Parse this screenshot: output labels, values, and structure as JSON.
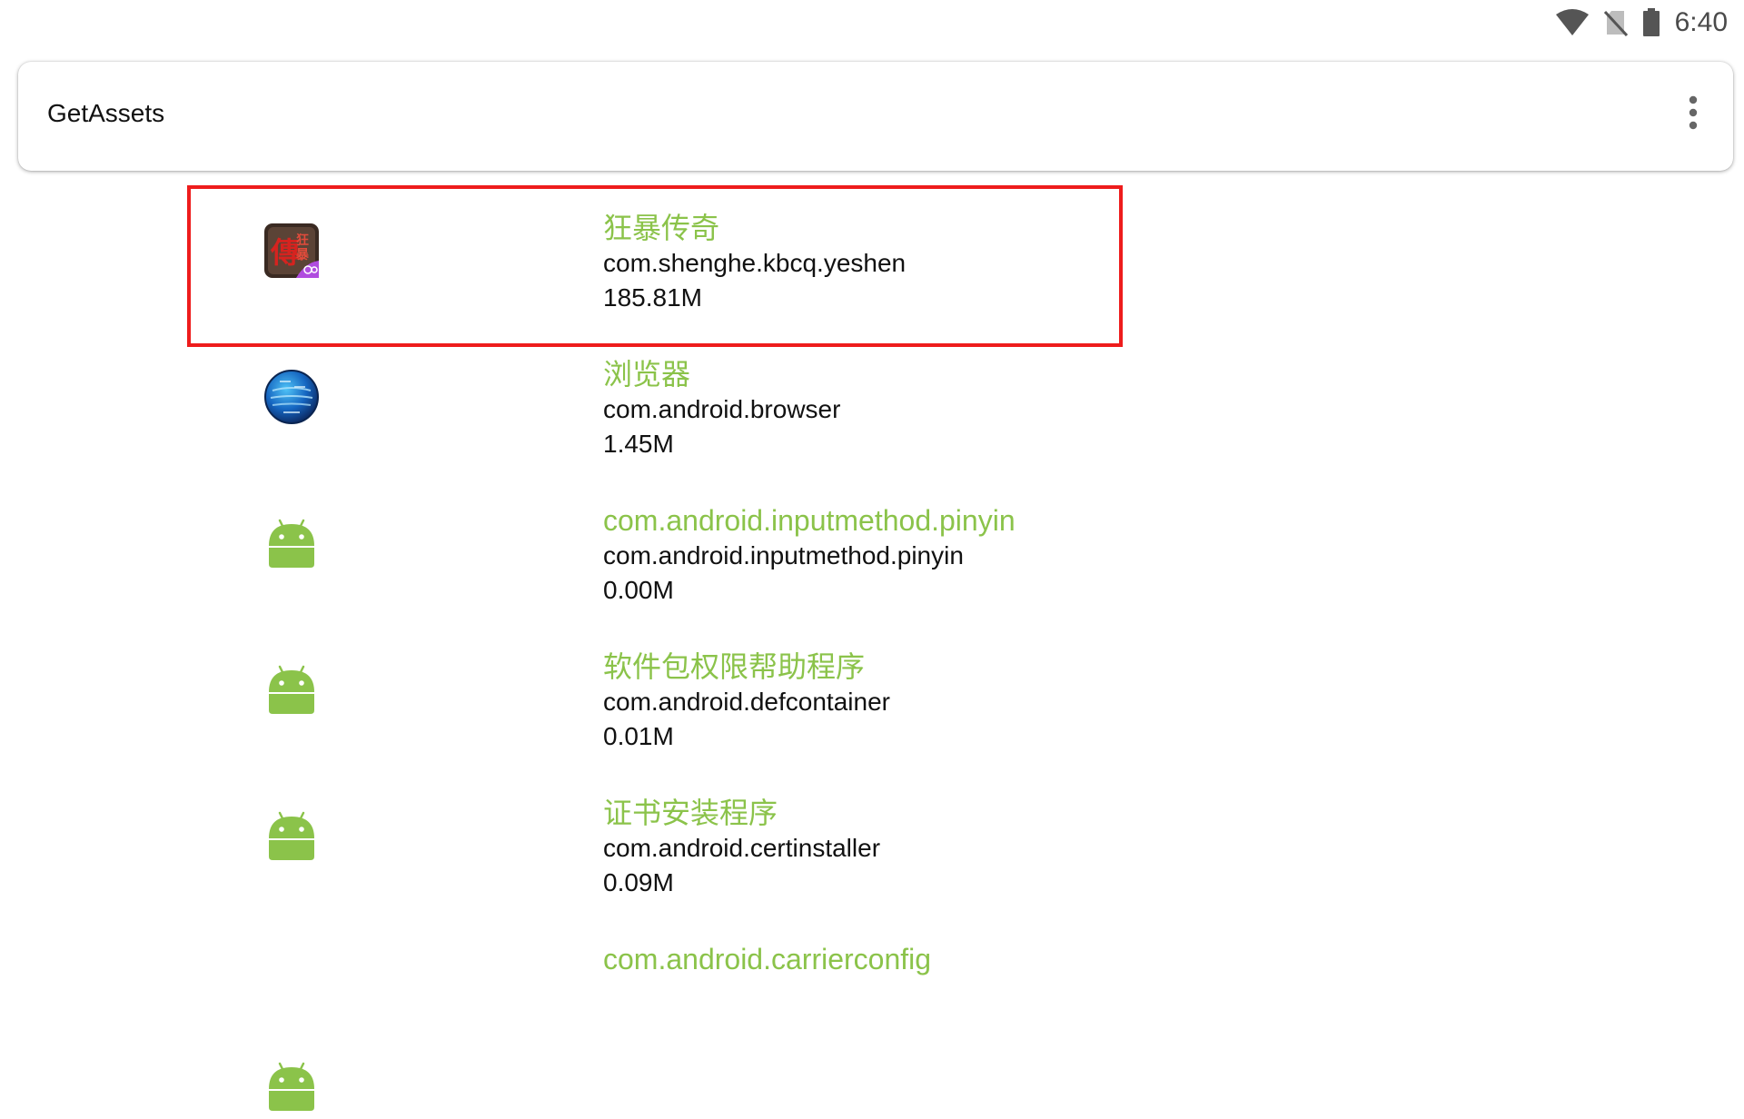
{
  "status_bar": {
    "time": "6:40",
    "icons": [
      "wifi-icon",
      "no-sim-icon",
      "battery-icon"
    ]
  },
  "app_bar": {
    "title": "GetAssets",
    "overflow_icon": "more-vert-icon"
  },
  "colors": {
    "label_green": "#8bc34a",
    "highlight_red": "#ee1c1c"
  },
  "apps": [
    {
      "label": "狂暴传奇",
      "package": "com.shenghe.kbcq.yeshen",
      "size": "185.81M",
      "icon": "game-icon"
    },
    {
      "label": "浏览器",
      "package": "com.android.browser",
      "size": "1.45M",
      "icon": "globe-icon"
    },
    {
      "label": "com.android.inputmethod.pinyin",
      "package": "com.android.inputmethod.pinyin",
      "size": "0.00M",
      "icon": "android-icon"
    },
    {
      "label": "软件包权限帮助程序",
      "package": "com.android.defcontainer",
      "size": "0.01M",
      "icon": "android-icon"
    },
    {
      "label": "证书安装程序",
      "package": "com.android.certinstaller",
      "size": "0.09M",
      "icon": "android-icon"
    },
    {
      "label": "com.android.carrierconfig",
      "package": "",
      "size": "",
      "icon": "android-icon"
    }
  ]
}
